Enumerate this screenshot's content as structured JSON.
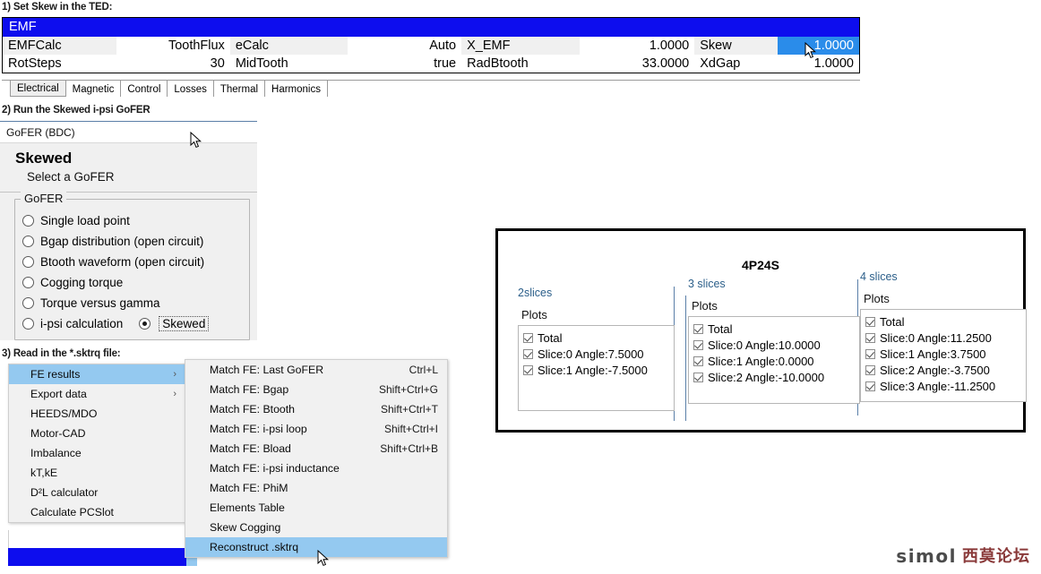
{
  "steps": {
    "step1": "1) Set Skew in the TED:",
    "step2": "2) Run the Skewed i-psi GoFER",
    "step3": "3) Read in the *.sktrq file:"
  },
  "ted": {
    "title": "EMF",
    "rows": [
      {
        "cells": [
          {
            "label": "EMFCalc",
            "value": "ToothFlux"
          },
          {
            "label": "eCalc",
            "value": "Auto"
          },
          {
            "label": "X_EMF",
            "value": "1.0000"
          },
          {
            "label": "Skew",
            "value": "1.0000",
            "selected": true
          }
        ]
      },
      {
        "cells": [
          {
            "label": "RotSteps",
            "value": "30"
          },
          {
            "label": "MidTooth",
            "value": "true"
          },
          {
            "label": "RadBtooth",
            "value": "33.0000"
          },
          {
            "label": "XdGap",
            "value": "1.0000"
          }
        ]
      }
    ],
    "selection_bg": "#2a8cea",
    "title_bg": "#0d0dee"
  },
  "tabs": [
    {
      "label": "Electrical",
      "active": true
    },
    {
      "label": "Magnetic",
      "active": false
    },
    {
      "label": "Control",
      "active": false
    },
    {
      "label": "Losses",
      "active": false
    },
    {
      "label": "Thermal",
      "active": false
    },
    {
      "label": "Harmonics",
      "active": false
    }
  ],
  "gofer": {
    "window_caption": "GoFER (BDC)",
    "title": "Skewed",
    "subtitle": "Select a GoFER",
    "group_legend": "GoFER",
    "options": [
      {
        "label": "Single load point",
        "checked": false
      },
      {
        "label": "Bgap distribution (open circuit)",
        "checked": false
      },
      {
        "label": "Btooth waveform (open circuit)",
        "checked": false
      },
      {
        "label": "Cogging torque",
        "checked": false
      },
      {
        "label": "Torque versus gamma",
        "checked": false
      },
      {
        "label": "i-psi calculation",
        "checked": false
      }
    ],
    "sub_option": {
      "label": "Skewed",
      "checked": true
    }
  },
  "menu_main": [
    {
      "label": "FE results",
      "submenu": true,
      "highlighted": true
    },
    {
      "label": "Export data",
      "submenu": true,
      "highlighted": false
    },
    {
      "label": "HEEDS/MDO",
      "submenu": false,
      "highlighted": false
    },
    {
      "label": "Motor-CAD",
      "submenu": false,
      "highlighted": false
    },
    {
      "label": "Imbalance",
      "submenu": false,
      "highlighted": false
    },
    {
      "label": "kT,kE",
      "submenu": false,
      "highlighted": false
    },
    {
      "label": "D²L calculator",
      "submenu": false,
      "highlighted": false
    },
    {
      "label": "Calculate PCSlot",
      "submenu": false,
      "highlighted": false
    }
  ],
  "menu_sub": [
    {
      "label": "Match FE: Last GoFER",
      "accel": "Ctrl+L",
      "highlighted": false
    },
    {
      "label": "Match FE: Bgap",
      "accel": "Shift+Ctrl+G",
      "highlighted": false
    },
    {
      "label": "Match FE: Btooth",
      "accel": "Shift+Ctrl+T",
      "highlighted": false
    },
    {
      "label": "Match FE: i-psi loop",
      "accel": "Shift+Ctrl+I",
      "highlighted": false
    },
    {
      "label": "Match FE: Bload",
      "accel": "Shift+Ctrl+B",
      "highlighted": false
    },
    {
      "label": "Match FE: i-psi inductance",
      "accel": "",
      "highlighted": false
    },
    {
      "label": "Match FE:  PhiM",
      "accel": "",
      "highlighted": false
    },
    {
      "label": "Elements Table",
      "accel": "",
      "highlighted": false
    },
    {
      "label": "Skew Cogging",
      "accel": "",
      "highlighted": false
    },
    {
      "label": "Reconstruct .sktrq",
      "accel": "",
      "highlighted": true
    }
  ],
  "results": {
    "title": "4P24S",
    "plots_label": "Plots",
    "groups": [
      {
        "legend": "2slices",
        "items": [
          {
            "label": "Total",
            "checked": true
          },
          {
            "label": "Slice:0 Angle:7.5000",
            "checked": true
          },
          {
            "label": "Slice:1 Angle:-7.5000",
            "checked": true
          }
        ]
      },
      {
        "legend": "3 slices",
        "items": [
          {
            "label": "Total",
            "checked": true
          },
          {
            "label": "Slice:0 Angle:10.0000",
            "checked": true
          },
          {
            "label": "Slice:1 Angle:0.0000",
            "checked": true
          },
          {
            "label": "Slice:2 Angle:-10.0000",
            "checked": true
          }
        ]
      },
      {
        "legend": "4 slices",
        "items": [
          {
            "label": "Total",
            "checked": true
          },
          {
            "label": "Slice:0 Angle:11.2500",
            "checked": true
          },
          {
            "label": "Slice:1 Angle:3.7500",
            "checked": true
          },
          {
            "label": "Slice:2 Angle:-3.7500",
            "checked": true
          },
          {
            "label": "Slice:3 Angle:-11.2500",
            "checked": true
          }
        ]
      }
    ]
  },
  "watermark": {
    "latin": "simol",
    "cjk": "西莫论坛"
  }
}
